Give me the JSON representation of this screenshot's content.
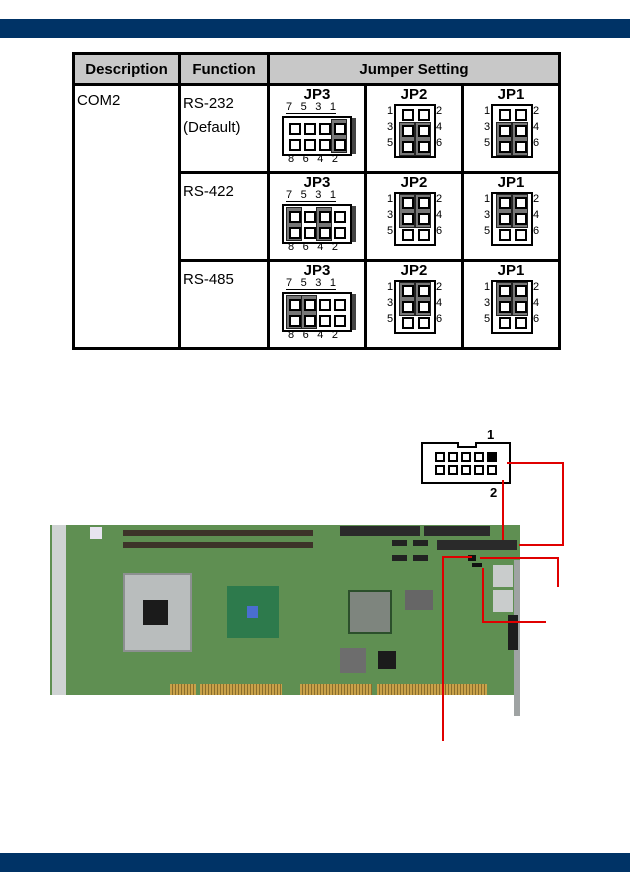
{
  "page": {
    "header_bar_color": "#003366",
    "footer_bar_color": "#003366"
  },
  "table": {
    "headers": [
      "Description",
      "Function",
      "Jumper Setting"
    ],
    "description": "COM2",
    "rows": [
      {
        "function": "RS-232",
        "function_note": "(Default)",
        "jp3": {
          "label": "JP3",
          "top_pins": [
            "7",
            "5",
            "3",
            "1"
          ],
          "bottom_pins": [
            "8",
            "6",
            "4",
            "2"
          ],
          "closed_pairs": [
            "1-2"
          ]
        },
        "jp2": {
          "label": "JP2",
          "left_pins": [
            "1",
            "3",
            "5"
          ],
          "right_pins": [
            "2",
            "4",
            "6"
          ],
          "closed_pairs": [
            "3-5",
            "4-6"
          ]
        },
        "jp1": {
          "label": "JP1",
          "left_pins": [
            "1",
            "3",
            "5"
          ],
          "right_pins": [
            "2",
            "4",
            "6"
          ],
          "closed_pairs": [
            "3-5",
            "4-6"
          ]
        }
      },
      {
        "function": "RS-422",
        "function_note": "",
        "jp3": {
          "label": "JP3",
          "top_pins": [
            "7",
            "5",
            "3",
            "1"
          ],
          "bottom_pins": [
            "8",
            "6",
            "4",
            "2"
          ],
          "closed_pairs": [
            "7-8",
            "3-4"
          ]
        },
        "jp2": {
          "label": "JP2",
          "left_pins": [
            "1",
            "3",
            "5"
          ],
          "right_pins": [
            "2",
            "4",
            "6"
          ],
          "closed_pairs": [
            "1-3",
            "2-4"
          ]
        },
        "jp1": {
          "label": "JP1",
          "left_pins": [
            "1",
            "3",
            "5"
          ],
          "right_pins": [
            "2",
            "4",
            "6"
          ],
          "closed_pairs": [
            "1-3",
            "2-4"
          ]
        }
      },
      {
        "function": "RS-485",
        "function_note": "",
        "jp3": {
          "label": "JP3",
          "top_pins": [
            "7",
            "5",
            "3",
            "1"
          ],
          "bottom_pins": [
            "8",
            "6",
            "4",
            "2"
          ],
          "closed_pairs": [
            "7-8",
            "5-6"
          ]
        },
        "jp2": {
          "label": "JP2",
          "left_pins": [
            "1",
            "3",
            "5"
          ],
          "right_pins": [
            "2",
            "4",
            "6"
          ],
          "closed_pairs": [
            "1-3",
            "2-4"
          ]
        },
        "jp1": {
          "label": "JP1",
          "left_pins": [
            "1",
            "3",
            "5"
          ],
          "right_pins": [
            "2",
            "4",
            "6"
          ],
          "closed_pairs": [
            "1-3",
            "2-4"
          ]
        }
      }
    ]
  },
  "diagram": {
    "connector_pin1_label": "1",
    "connector_pin2_label": "2",
    "connector_pin_count": 10,
    "callout_color": "#e00000",
    "board_color": "#5f8f52"
  }
}
